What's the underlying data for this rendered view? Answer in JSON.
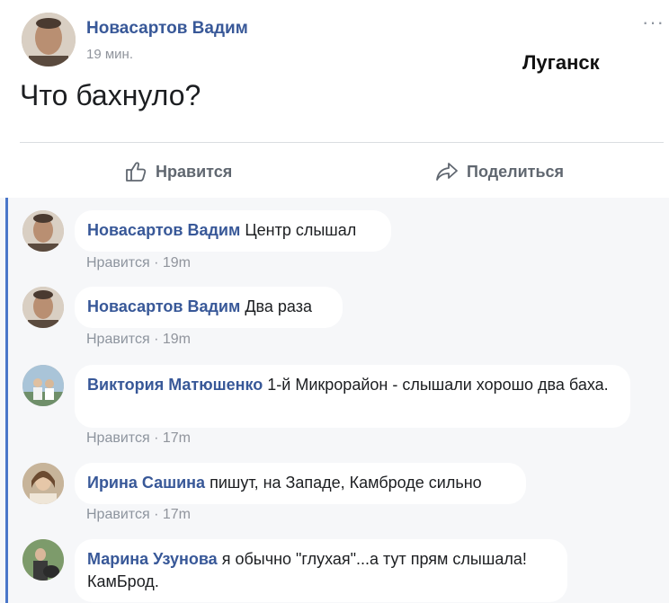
{
  "post": {
    "author": "Новасартов Вадим",
    "time": "19 мин.",
    "city_label": "Луганск",
    "text": "Что бахнуло?",
    "more_label": "···",
    "like_label": "Нравится",
    "share_label": "Поделиться"
  },
  "comments": [
    {
      "author": "Новасартов Вадим",
      "text": "Центр слышал",
      "like": "Нравится",
      "time": "19m"
    },
    {
      "author": "Новасартов Вадим",
      "text": "Два раза",
      "like": "Нравится",
      "time": "19m"
    },
    {
      "author": "Виктория Матюшенко",
      "text": "1-й Микрорайон - слышали хорошо два баха.",
      "like": "Нравится",
      "time": "17m"
    },
    {
      "author": "Ирина Сашина",
      "text": "пишут, на Западе, Камброде сильно",
      "like": "Нравится",
      "time": "17m"
    },
    {
      "author": "Марина Узунова",
      "text": "я обычно \"глухая\"...а тут прям слышала! КамБрод.",
      "like": "",
      "time": ""
    }
  ],
  "meta_separator": "·",
  "colors": {
    "author_blue": "#385898",
    "meta_gray": "#90949c",
    "rail_blue": "#4a76c9",
    "comments_bg": "#f6f7f9"
  },
  "icons": [
    "more-icon",
    "like-thumb-icon",
    "share-arrow-icon"
  ]
}
